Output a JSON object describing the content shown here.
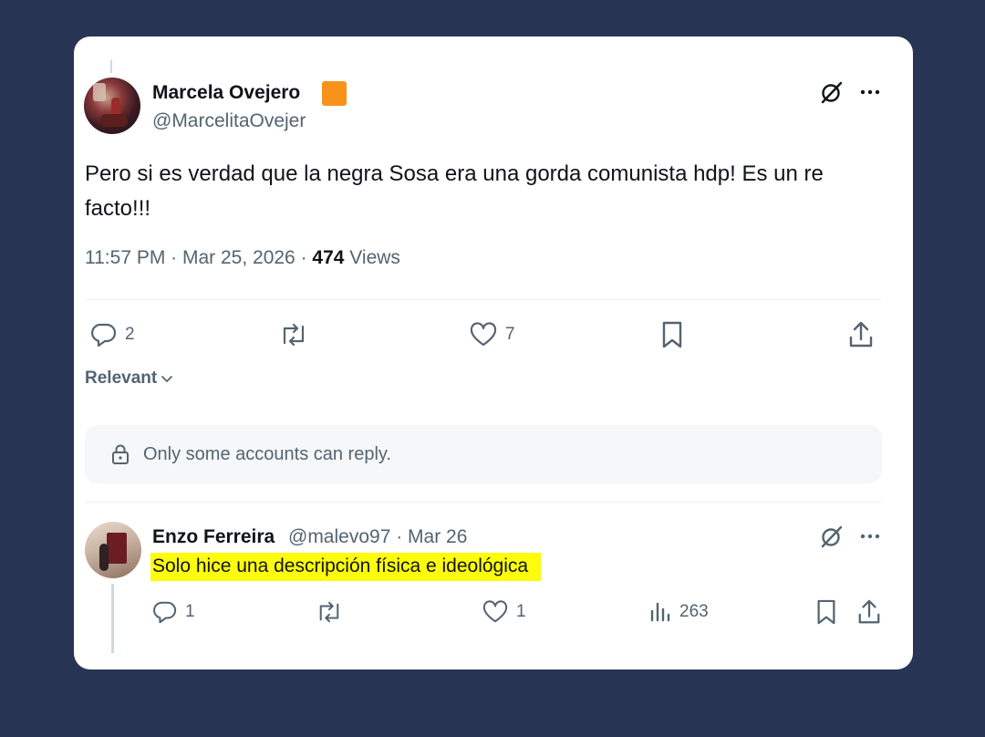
{
  "tweet": {
    "author_name": "Marcela Ovejero",
    "author_handle": "@MarcelitaOvejer",
    "text": "Pero si es verdad que la negra Sosa era una gorda comunista hdp! Es un re facto!!!",
    "time": "11:57 PM · Mar 25, 2026 · ",
    "views_count": "474",
    "views_label": " Views",
    "replies": "2",
    "likes": "7",
    "verified_color": "#f7931a"
  },
  "sort_label": "Relevant",
  "reply_restriction": "Only some accounts can reply.",
  "reply": {
    "author_name": "Enzo Ferreira",
    "author_handle": "@malevo97 · Mar 26",
    "text": "Solo hice una descripción física e ideológica",
    "replies": "1",
    "likes": "1",
    "views": "263",
    "highlight_color": "#fdfc0c"
  },
  "icons": [
    "grok-icon",
    "more-icon",
    "reply-icon",
    "retweet-icon",
    "like-icon",
    "bookmark-icon",
    "share-icon",
    "chevron-down-icon",
    "lock-icon",
    "views-icon"
  ],
  "colors": {
    "background": "#283453",
    "card": "#ffffff",
    "muted_text": "#536471",
    "text": "#0f1419"
  }
}
